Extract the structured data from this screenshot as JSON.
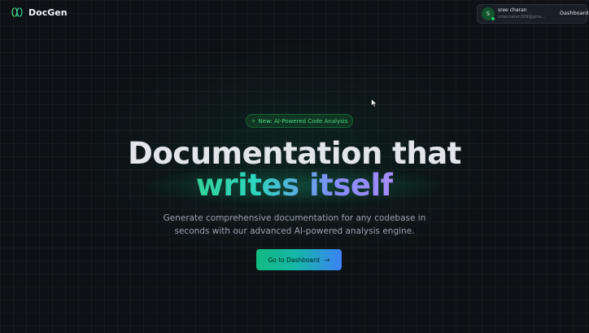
{
  "brand": {
    "name": "DocGen",
    "logo_icon": "docgen-logo-icon"
  },
  "user": {
    "initial": "S",
    "name": "sree charan",
    "email": "sreecharan309@gma...",
    "nav_label": "Dashboard"
  },
  "hero": {
    "badge_icon": "sparkles-icon",
    "badge_text": "New: AI-Powered Code Analysis",
    "title_line1": "Documentation that",
    "title_line2": "writes itself",
    "subtitle": "Generate comprehensive documentation for any codebase in seconds with our advanced AI-powered analysis engine.",
    "cta_label": "Go to Dashboard",
    "cta_icon": "arrow-right-icon"
  },
  "colors": {
    "background": "#0d1014",
    "accent_green": "#10b981",
    "accent_blue": "#3b82f6",
    "badge_text": "#4ade80"
  }
}
